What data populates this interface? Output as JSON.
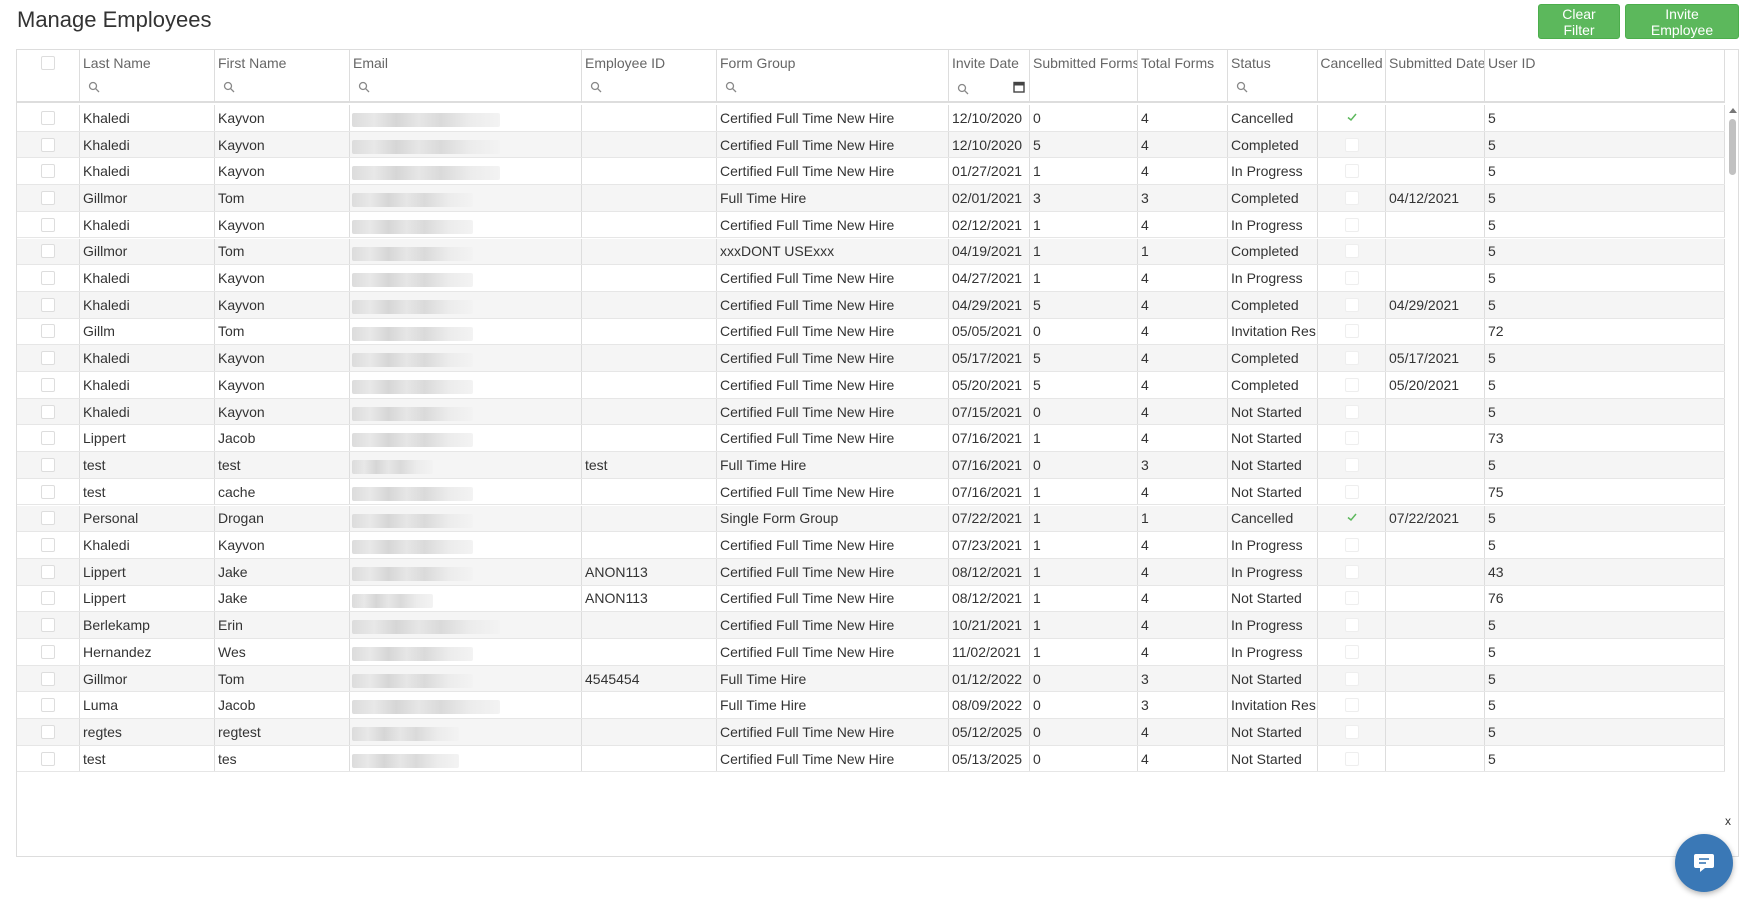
{
  "page": {
    "title": "Manage Employees"
  },
  "toolbar": {
    "clear_filter_label": "Clear Filter",
    "invite_employee_label": "Invite Employee"
  },
  "colors": {
    "accent_green": "#5cb85c",
    "chat_blue": "#3a78b6",
    "check_green": "#5cb85c"
  },
  "columns": [
    "",
    "Last Name",
    "First Name",
    "Email",
    "Employee ID",
    "Form Group",
    "Invite Date",
    "Submitted Forms",
    "Total Forms",
    "Status",
    "Cancelled",
    "Submitted Date",
    "User ID"
  ],
  "filter_icons": {
    "search": "search-icon",
    "date": "calendar-icon"
  },
  "rows": [
    {
      "last": "Khaledi",
      "first": "Kayvon",
      "empid": "",
      "group": "Certified Full Time New Hire",
      "invite": "12/10/2020",
      "submitted": "0",
      "total": "4",
      "status": "Cancelled",
      "cancelled": true,
      "subdate": "",
      "userid": "5"
    },
    {
      "last": "Khaledi",
      "first": "Kayvon",
      "empid": "",
      "group": "Certified Full Time New Hire",
      "invite": "12/10/2020",
      "submitted": "5",
      "total": "4",
      "status": "Completed",
      "cancelled": false,
      "subdate": "",
      "userid": "5"
    },
    {
      "last": "Khaledi",
      "first": "Kayvon",
      "empid": "",
      "group": "Certified Full Time New Hire",
      "invite": "01/27/2021",
      "submitted": "1",
      "total": "4",
      "status": "In Progress",
      "cancelled": false,
      "subdate": "",
      "userid": "5"
    },
    {
      "last": "Gillmor",
      "first": "Tom",
      "empid": "",
      "group": "Full Time Hire",
      "invite": "02/01/2021",
      "submitted": "3",
      "total": "3",
      "status": "Completed",
      "cancelled": false,
      "subdate": "04/12/2021",
      "userid": "5"
    },
    {
      "last": "Khaledi",
      "first": "Kayvon",
      "empid": "",
      "group": "Certified Full Time New Hire",
      "invite": "02/12/2021",
      "submitted": "1",
      "total": "4",
      "status": "In Progress",
      "cancelled": false,
      "subdate": "",
      "userid": "5"
    },
    {
      "last": "Gillmor",
      "first": "Tom",
      "empid": "",
      "group": "xxxDONT USExxx",
      "invite": "04/19/2021",
      "submitted": "1",
      "total": "1",
      "status": "Completed",
      "cancelled": false,
      "subdate": "",
      "userid": "5"
    },
    {
      "last": "Khaledi",
      "first": "Kayvon",
      "empid": "",
      "group": "Certified Full Time New Hire",
      "invite": "04/27/2021",
      "submitted": "1",
      "total": "4",
      "status": "In Progress",
      "cancelled": false,
      "subdate": "",
      "userid": "5"
    },
    {
      "last": "Khaledi",
      "first": "Kayvon",
      "empid": "",
      "group": "Certified Full Time New Hire",
      "invite": "04/29/2021",
      "submitted": "5",
      "total": "4",
      "status": "Completed",
      "cancelled": false,
      "subdate": "04/29/2021",
      "userid": "5"
    },
    {
      "last": "Gillm",
      "first": "Tom",
      "empid": "",
      "group": "Certified Full Time New Hire",
      "invite": "05/05/2021",
      "submitted": "0",
      "total": "4",
      "status": "Invitation Res...",
      "cancelled": false,
      "subdate": "",
      "userid": "72"
    },
    {
      "last": "Khaledi",
      "first": "Kayvon",
      "empid": "",
      "group": "Certified Full Time New Hire",
      "invite": "05/17/2021",
      "submitted": "5",
      "total": "4",
      "status": "Completed",
      "cancelled": false,
      "subdate": "05/17/2021",
      "userid": "5"
    },
    {
      "last": "Khaledi",
      "first": "Kayvon",
      "empid": "",
      "group": "Certified Full Time New Hire",
      "invite": "05/20/2021",
      "submitted": "5",
      "total": "4",
      "status": "Completed",
      "cancelled": false,
      "subdate": "05/20/2021",
      "userid": "5"
    },
    {
      "last": "Khaledi",
      "first": "Kayvon",
      "empid": "",
      "group": "Certified Full Time New Hire",
      "invite": "07/15/2021",
      "submitted": "0",
      "total": "4",
      "status": "Not Started",
      "cancelled": false,
      "subdate": "",
      "userid": "5"
    },
    {
      "last": "Lippert",
      "first": "Jacob",
      "empid": "",
      "group": "Certified Full Time New Hire",
      "invite": "07/16/2021",
      "submitted": "1",
      "total": "4",
      "status": "Not Started",
      "cancelled": false,
      "subdate": "",
      "userid": "73"
    },
    {
      "last": "test",
      "first": "test",
      "empid": "test",
      "group": "Full Time Hire",
      "invite": "07/16/2021",
      "submitted": "0",
      "total": "3",
      "status": "Not Started",
      "cancelled": false,
      "subdate": "",
      "userid": "5"
    },
    {
      "last": "test",
      "first": "cache",
      "empid": "",
      "group": "Certified Full Time New Hire",
      "invite": "07/16/2021",
      "submitted": "1",
      "total": "4",
      "status": "Not Started",
      "cancelled": false,
      "subdate": "",
      "userid": "75"
    },
    {
      "last": "Personal",
      "first": "Drogan",
      "empid": "",
      "group": "Single Form Group",
      "invite": "07/22/2021",
      "submitted": "1",
      "total": "1",
      "status": "Cancelled",
      "cancelled": true,
      "subdate": "07/22/2021",
      "userid": "5"
    },
    {
      "last": "Khaledi",
      "first": "Kayvon",
      "empid": "",
      "group": "Certified Full Time New Hire",
      "invite": "07/23/2021",
      "submitted": "1",
      "total": "4",
      "status": "In Progress",
      "cancelled": false,
      "subdate": "",
      "userid": "5"
    },
    {
      "last": "Lippert",
      "first": "Jake",
      "empid": "ANON113",
      "group": "Certified Full Time New Hire",
      "invite": "08/12/2021",
      "submitted": "1",
      "total": "4",
      "status": "In Progress",
      "cancelled": false,
      "subdate": "",
      "userid": "43"
    },
    {
      "last": "Lippert",
      "first": "Jake",
      "empid": "ANON113",
      "group": "Certified Full Time New Hire",
      "invite": "08/12/2021",
      "submitted": "1",
      "total": "4",
      "status": "Not Started",
      "cancelled": false,
      "subdate": "",
      "userid": "76"
    },
    {
      "last": "Berlekamp",
      "first": "Erin",
      "empid": "",
      "group": "Certified Full Time New Hire",
      "invite": "10/21/2021",
      "submitted": "1",
      "total": "4",
      "status": "In Progress",
      "cancelled": false,
      "subdate": "",
      "userid": "5"
    },
    {
      "last": "Hernandez",
      "first": "Wes",
      "empid": "",
      "group": "Certified Full Time New Hire",
      "invite": "11/02/2021",
      "submitted": "1",
      "total": "4",
      "status": "In Progress",
      "cancelled": false,
      "subdate": "",
      "userid": "5"
    },
    {
      "last": "Gillmor",
      "first": "Tom",
      "empid": "4545454",
      "group": "Full Time Hire",
      "invite": "01/12/2022",
      "submitted": "0",
      "total": "3",
      "status": "Not Started",
      "cancelled": false,
      "subdate": "",
      "userid": "5"
    },
    {
      "last": "Luma",
      "first": "Jacob",
      "empid": "",
      "group": "Full Time Hire",
      "invite": "08/09/2022",
      "submitted": "0",
      "total": "3",
      "status": "Invitation Res...",
      "cancelled": false,
      "subdate": "",
      "userid": "5"
    },
    {
      "last": "regtes",
      "first": "regtest",
      "empid": "",
      "group": "Certified Full Time New Hire",
      "invite": "05/12/2025",
      "submitted": "0",
      "total": "4",
      "status": "Not Started",
      "cancelled": false,
      "subdate": "",
      "userid": "5"
    },
    {
      "last": "test",
      "first": "tes",
      "empid": "",
      "group": "Certified Full Time New Hire",
      "invite": "05/13/2025",
      "submitted": "0",
      "total": "4",
      "status": "Not Started",
      "cancelled": false,
      "subdate": "",
      "userid": "5"
    }
  ],
  "chat": {
    "close_label": "x",
    "icon": "chat-icon"
  }
}
